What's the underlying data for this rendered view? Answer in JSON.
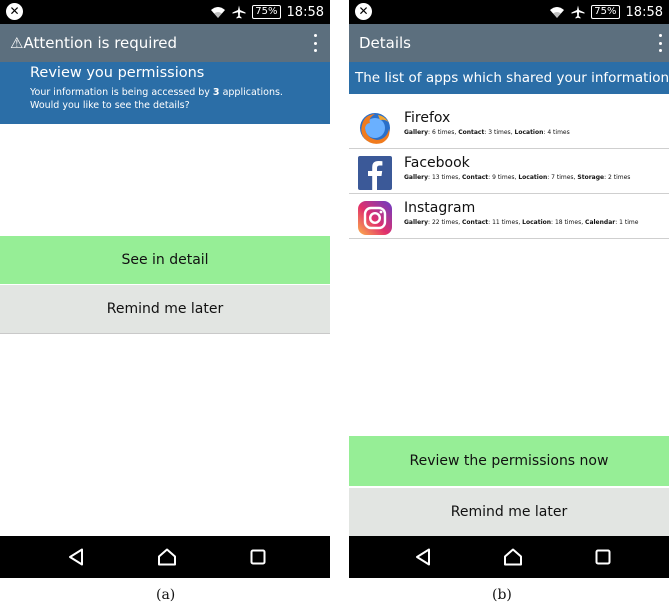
{
  "panel_a": {
    "status": {
      "battery": "75%",
      "time": "18:58"
    },
    "appbar": {
      "title": "Attention is required",
      "warning_glyph": "⚠"
    },
    "banner": {
      "title": "Review you permissions",
      "line1_prefix": "Your information is being accessed by ",
      "line1_count": "3",
      "line1_suffix": " applications.",
      "line2": "Would you like to see the details?"
    },
    "buttons": {
      "see_detail": "See in detail",
      "remind_later": "Remind me later"
    },
    "caption": "(a)"
  },
  "panel_b": {
    "status": {
      "battery": "75%",
      "time": "18:58"
    },
    "appbar": {
      "title": "Details"
    },
    "banner": "The list of apps which shared your information",
    "apps": [
      {
        "name": "Firefox",
        "icon": "firefox-icon",
        "details": [
          {
            "label": "Gallery",
            "value": "6 times"
          },
          {
            "label": "Contact",
            "value": "3 times"
          },
          {
            "label": "Location",
            "value": "4 times"
          }
        ]
      },
      {
        "name": "Facebook",
        "icon": "facebook-icon",
        "details": [
          {
            "label": "Gallery",
            "value": "13 times"
          },
          {
            "label": "Contact",
            "value": "9 times"
          },
          {
            "label": "Location",
            "value": "7 times"
          },
          {
            "label": "Storage",
            "value": "2 times"
          }
        ]
      },
      {
        "name": "Instagram",
        "icon": "instagram-icon",
        "details": [
          {
            "label": "Gallery",
            "value": "22 times"
          },
          {
            "label": "Contact",
            "value": "11 times"
          },
          {
            "label": "Location",
            "value": "18 times"
          },
          {
            "label": "Calendar",
            "value": "1 time"
          }
        ]
      }
    ],
    "buttons": {
      "review_now": "Review the permissions now",
      "remind_later": "Remind me later"
    },
    "caption": "(b)"
  },
  "colors": {
    "appbar": "#5c6f7e",
    "banner": "#2b6ea7",
    "primary_button": "#96ee96",
    "secondary_button": "#e2e5e2"
  }
}
